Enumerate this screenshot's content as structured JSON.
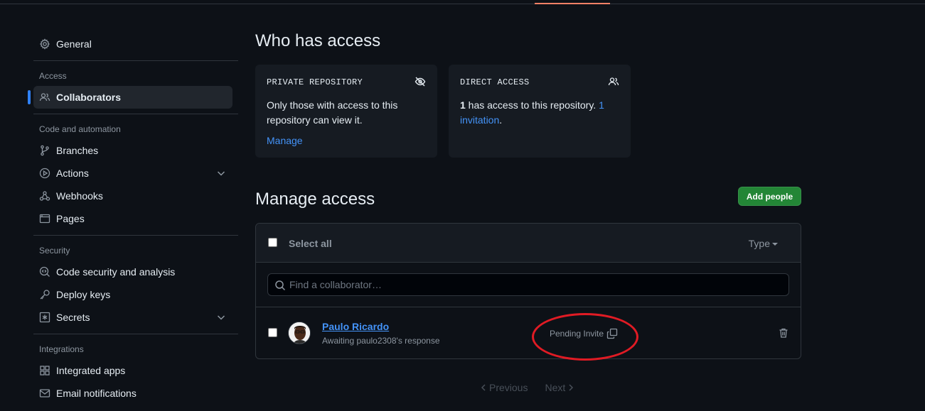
{
  "sidebar": {
    "general": "General",
    "sections": {
      "access": "Access",
      "code_automation": "Code and automation",
      "security": "Security",
      "integrations": "Integrations"
    },
    "items": {
      "collaborators": "Collaborators",
      "branches": "Branches",
      "actions": "Actions",
      "webhooks": "Webhooks",
      "pages": "Pages",
      "code_security": "Code security and analysis",
      "deploy_keys": "Deploy keys",
      "secrets": "Secrets",
      "integrated_apps": "Integrated apps",
      "email_notifications": "Email notifications"
    }
  },
  "who": {
    "title": "Who has access",
    "private": {
      "caption": "PRIVATE REPOSITORY",
      "text": "Only those with access to this repository can view it.",
      "link": "Manage"
    },
    "direct": {
      "caption": "DIRECT ACCESS",
      "count": "1",
      "text_mid": " has access to this repository. ",
      "invite_link": "1 invitation",
      "period": "."
    }
  },
  "manage": {
    "title": "Manage access",
    "add_button": "Add people",
    "select_all": "Select all",
    "type_filter": "Type",
    "search_placeholder": "Find a collaborator…",
    "collaborator": {
      "name": "Paulo Ricardo",
      "status": "Awaiting paulo2308's response",
      "badge": "Pending Invite"
    },
    "pagination": {
      "previous": "Previous",
      "next": "Next"
    }
  },
  "colors": {
    "accent": "#2f81f7",
    "link": "#4493f8",
    "primary_button": "#238636",
    "annotation_circle": "#e01b24"
  },
  "icons": [
    "gear-icon",
    "people-icon",
    "git-branch-icon",
    "play-icon",
    "webhook-icon",
    "browser-icon",
    "codescan-icon",
    "key-icon",
    "asterisk-icon",
    "apps-icon",
    "mail-icon",
    "eye-closed-icon",
    "search-icon",
    "copy-icon",
    "trash-icon",
    "chevron-down-icon",
    "chevron-left-icon",
    "chevron-right-icon"
  ]
}
